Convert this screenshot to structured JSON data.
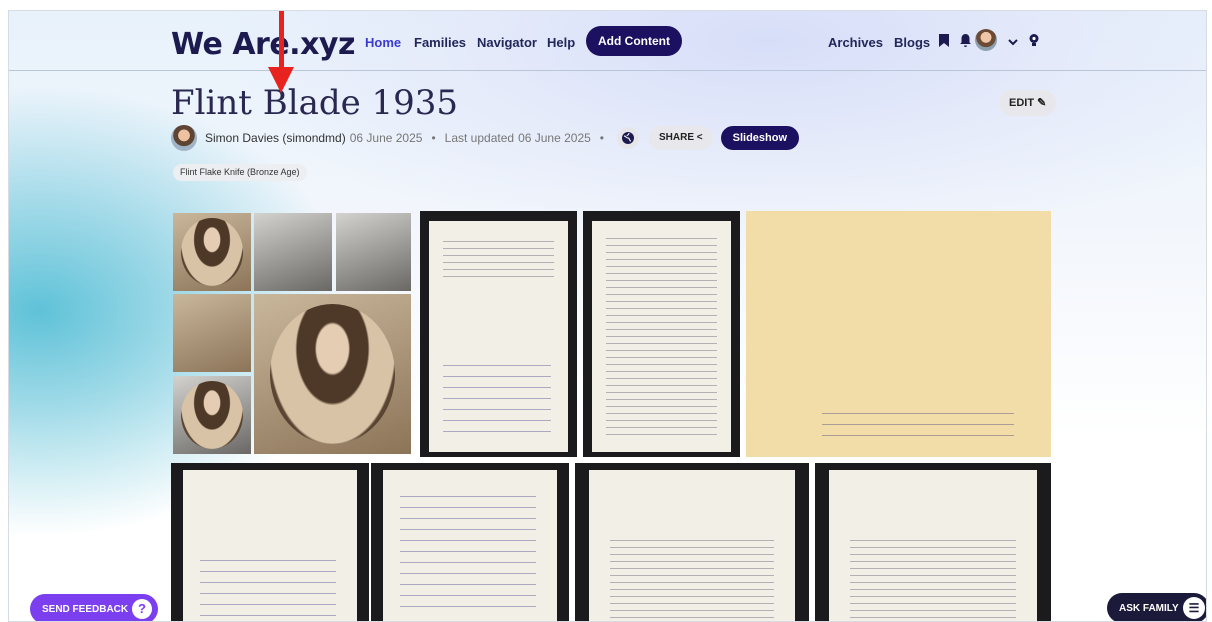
{
  "nav": {
    "logo": "We Are.xyz",
    "links": [
      "Home",
      "Families",
      "Navigator",
      "Help"
    ],
    "add_content": "Add Content",
    "right_links": [
      "Archives",
      "Blogs"
    ],
    "icons": [
      "bookmark-icon",
      "bell-icon",
      "user-avatar",
      "chevron-down-icon",
      "lightbulb-icon"
    ]
  },
  "page": {
    "title": "Flint Blade 1935",
    "edit": "EDIT",
    "author": "Simon Davies (simondmd)",
    "created": "06 June 2025",
    "updated_prefix": "Last updated",
    "updated": "06 June 2025",
    "share": "SHARE",
    "slideshow": "Slideshow",
    "tag": "Flint Flake Knife (Bronze Age)"
  },
  "buttons": {
    "send_feedback": "SEND FEEDBACK",
    "ask_family": "ASK FAMILY"
  },
  "colors": {
    "brand_dark": "#1c1060",
    "accent_blue": "#3b3bd0",
    "feedback": "#7b3ff0",
    "annotation_arrow": "#e8231f"
  }
}
